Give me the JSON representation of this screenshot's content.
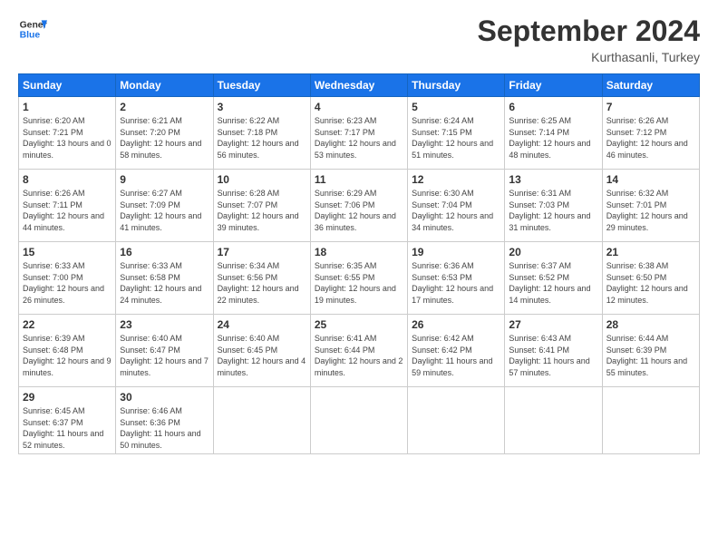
{
  "logo": {
    "line1": "General",
    "line2": "Blue"
  },
  "title": "September 2024",
  "location": "Kurthasanli, Turkey",
  "days_header": [
    "Sunday",
    "Monday",
    "Tuesday",
    "Wednesday",
    "Thursday",
    "Friday",
    "Saturday"
  ],
  "weeks": [
    [
      {
        "day": "1",
        "sunrise": "6:20 AM",
        "sunset": "7:21 PM",
        "daylight": "13 hours and 0 minutes."
      },
      {
        "day": "2",
        "sunrise": "6:21 AM",
        "sunset": "7:20 PM",
        "daylight": "12 hours and 58 minutes."
      },
      {
        "day": "3",
        "sunrise": "6:22 AM",
        "sunset": "7:18 PM",
        "daylight": "12 hours and 56 minutes."
      },
      {
        "day": "4",
        "sunrise": "6:23 AM",
        "sunset": "7:17 PM",
        "daylight": "12 hours and 53 minutes."
      },
      {
        "day": "5",
        "sunrise": "6:24 AM",
        "sunset": "7:15 PM",
        "daylight": "12 hours and 51 minutes."
      },
      {
        "day": "6",
        "sunrise": "6:25 AM",
        "sunset": "7:14 PM",
        "daylight": "12 hours and 48 minutes."
      },
      {
        "day": "7",
        "sunrise": "6:26 AM",
        "sunset": "7:12 PM",
        "daylight": "12 hours and 46 minutes."
      }
    ],
    [
      {
        "day": "8",
        "sunrise": "6:26 AM",
        "sunset": "7:11 PM",
        "daylight": "12 hours and 44 minutes."
      },
      {
        "day": "9",
        "sunrise": "6:27 AM",
        "sunset": "7:09 PM",
        "daylight": "12 hours and 41 minutes."
      },
      {
        "day": "10",
        "sunrise": "6:28 AM",
        "sunset": "7:07 PM",
        "daylight": "12 hours and 39 minutes."
      },
      {
        "day": "11",
        "sunrise": "6:29 AM",
        "sunset": "7:06 PM",
        "daylight": "12 hours and 36 minutes."
      },
      {
        "day": "12",
        "sunrise": "6:30 AM",
        "sunset": "7:04 PM",
        "daylight": "12 hours and 34 minutes."
      },
      {
        "day": "13",
        "sunrise": "6:31 AM",
        "sunset": "7:03 PM",
        "daylight": "12 hours and 31 minutes."
      },
      {
        "day": "14",
        "sunrise": "6:32 AM",
        "sunset": "7:01 PM",
        "daylight": "12 hours and 29 minutes."
      }
    ],
    [
      {
        "day": "15",
        "sunrise": "6:33 AM",
        "sunset": "7:00 PM",
        "daylight": "12 hours and 26 minutes."
      },
      {
        "day": "16",
        "sunrise": "6:33 AM",
        "sunset": "6:58 PM",
        "daylight": "12 hours and 24 minutes."
      },
      {
        "day": "17",
        "sunrise": "6:34 AM",
        "sunset": "6:56 PM",
        "daylight": "12 hours and 22 minutes."
      },
      {
        "day": "18",
        "sunrise": "6:35 AM",
        "sunset": "6:55 PM",
        "daylight": "12 hours and 19 minutes."
      },
      {
        "day": "19",
        "sunrise": "6:36 AM",
        "sunset": "6:53 PM",
        "daylight": "12 hours and 17 minutes."
      },
      {
        "day": "20",
        "sunrise": "6:37 AM",
        "sunset": "6:52 PM",
        "daylight": "12 hours and 14 minutes."
      },
      {
        "day": "21",
        "sunrise": "6:38 AM",
        "sunset": "6:50 PM",
        "daylight": "12 hours and 12 minutes."
      }
    ],
    [
      {
        "day": "22",
        "sunrise": "6:39 AM",
        "sunset": "6:48 PM",
        "daylight": "12 hours and 9 minutes."
      },
      {
        "day": "23",
        "sunrise": "6:40 AM",
        "sunset": "6:47 PM",
        "daylight": "12 hours and 7 minutes."
      },
      {
        "day": "24",
        "sunrise": "6:40 AM",
        "sunset": "6:45 PM",
        "daylight": "12 hours and 4 minutes."
      },
      {
        "day": "25",
        "sunrise": "6:41 AM",
        "sunset": "6:44 PM",
        "daylight": "12 hours and 2 minutes."
      },
      {
        "day": "26",
        "sunrise": "6:42 AM",
        "sunset": "6:42 PM",
        "daylight": "11 hours and 59 minutes."
      },
      {
        "day": "27",
        "sunrise": "6:43 AM",
        "sunset": "6:41 PM",
        "daylight": "11 hours and 57 minutes."
      },
      {
        "day": "28",
        "sunrise": "6:44 AM",
        "sunset": "6:39 PM",
        "daylight": "11 hours and 55 minutes."
      }
    ],
    [
      {
        "day": "29",
        "sunrise": "6:45 AM",
        "sunset": "6:37 PM",
        "daylight": "11 hours and 52 minutes."
      },
      {
        "day": "30",
        "sunrise": "6:46 AM",
        "sunset": "6:36 PM",
        "daylight": "11 hours and 50 minutes."
      },
      null,
      null,
      null,
      null,
      null
    ]
  ]
}
